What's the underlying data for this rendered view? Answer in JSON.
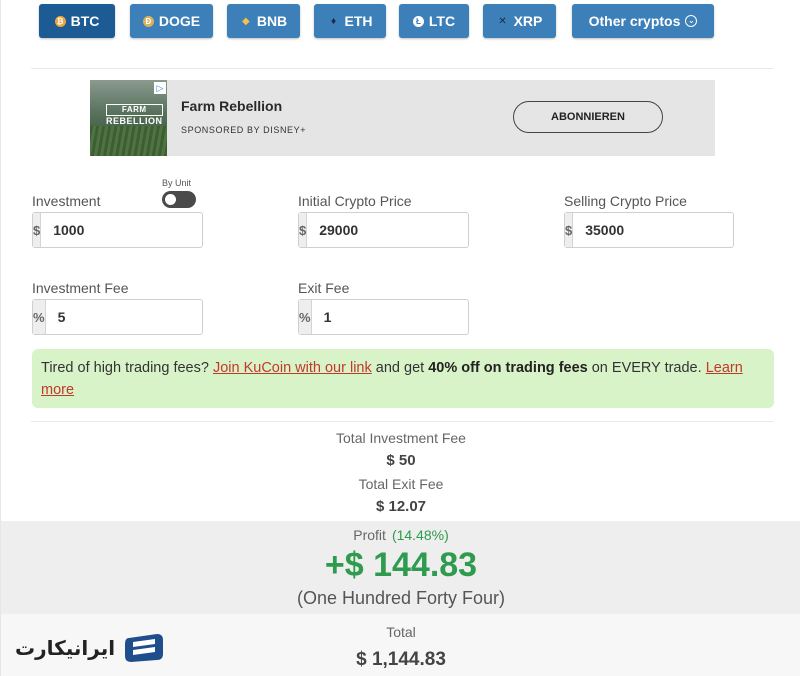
{
  "tabs": [
    {
      "label": "BTC",
      "icon": "bitcoin-icon",
      "active": true
    },
    {
      "label": "DOGE",
      "icon": "dogecoin-icon",
      "active": false
    },
    {
      "label": "BNB",
      "icon": "bnb-icon",
      "active": false
    },
    {
      "label": "ETH",
      "icon": "ethereum-icon",
      "active": false
    },
    {
      "label": "LTC",
      "icon": "litecoin-icon",
      "active": false
    },
    {
      "label": "XRP",
      "icon": "xrp-icon",
      "active": false
    },
    {
      "label": "Other cryptos",
      "icon": "chevron-down-icon",
      "active": false
    }
  ],
  "ad": {
    "image_text_top": "FARM",
    "image_text_bottom": "REBELLION",
    "title": "Farm Rebellion",
    "sponsor": "SPONSORED BY DISNEY+",
    "button": "ABONNIEREN"
  },
  "form": {
    "investment": {
      "label": "Investment",
      "prefix": "$",
      "value": "1000"
    },
    "by_unit_label": "By Unit",
    "initial_price": {
      "label": "Initial Crypto Price",
      "prefix": "$",
      "value": "29000"
    },
    "selling_price": {
      "label": "Selling Crypto Price",
      "prefix": "$",
      "value": "35000"
    },
    "investment_fee": {
      "label": "Investment Fee",
      "prefix": "%",
      "value": "5"
    },
    "exit_fee": {
      "label": "Exit Fee",
      "prefix": "%",
      "value": "1"
    }
  },
  "promo": {
    "text1": "Tired of high trading fees? ",
    "link1": "Join KuCoin with our link",
    "text2": " and get ",
    "bold": "40% off on trading fees",
    "text3": " on EVERY trade. ",
    "link2": "Learn more"
  },
  "results": {
    "total_investment_fee_label": "Total Investment Fee",
    "total_investment_fee": "$ 50",
    "total_exit_fee_label": "Total Exit Fee",
    "total_exit_fee": "$ 12.07",
    "profit_label": "Profit",
    "profit_pct": "(14.48%)",
    "profit_value": "+$ 144.83",
    "profit_words": "(One Hundred Forty Four)",
    "total_label": "Total",
    "total_value": "$ 1,144.83"
  },
  "watermark": {
    "text": "ایرانیکارت"
  },
  "colors": {
    "tab": "#3d7fb8",
    "tab_active": "#1d5b94",
    "profit": "#2e9b4e",
    "promo_bg": "#d9f3c9",
    "link": "#c0392b"
  }
}
